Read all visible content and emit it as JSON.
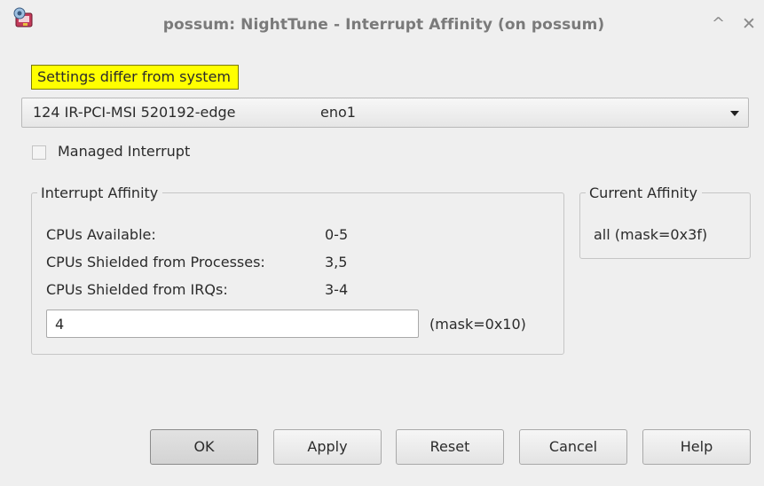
{
  "window": {
    "title": "possum: NightTune - Interrupt Affinity (on possum)",
    "controls": {
      "minimize": "^",
      "close": "✕"
    }
  },
  "warning": {
    "text": "Settings differ from system"
  },
  "interrupt_select": {
    "irq": "124 IR-PCI-MSI 520192-edge",
    "device": "eno1"
  },
  "managed_interrupt": {
    "label": "Managed Interrupt",
    "checked": false
  },
  "interrupt_affinity": {
    "legend": "Interrupt Affinity",
    "rows": [
      {
        "label": "CPUs Available:",
        "value": "0-5"
      },
      {
        "label": "CPUs Shielded from Processes:",
        "value": "3,5"
      },
      {
        "label": "CPUs Shielded from IRQs:",
        "value": "3-4"
      }
    ],
    "input_value": "4",
    "mask": "(mask=0x10)"
  },
  "current_affinity": {
    "legend": "Current Affinity",
    "value": "all (mask=0x3f)"
  },
  "buttons": {
    "ok": "OK",
    "apply": "Apply",
    "reset": "Reset",
    "cancel": "Cancel",
    "help": "Help"
  }
}
